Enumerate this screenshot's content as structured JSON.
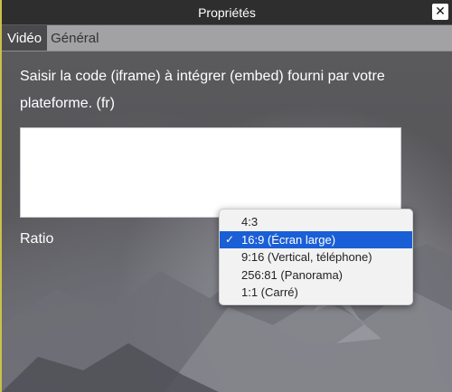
{
  "window": {
    "title": "Propriétés",
    "close_glyph": "✕"
  },
  "tabs": [
    {
      "label": "Vidéo",
      "active": true
    },
    {
      "label": "Général",
      "active": false
    }
  ],
  "form": {
    "prompt": "Saisir la code (iframe) à intégrer (embed) fourni par votre plateforme. (fr)",
    "embed_value": "",
    "ratio_label": "Ratio"
  },
  "ratio_dropdown": {
    "selected": "16:9 (Écran large)",
    "options": [
      {
        "label": "4:3",
        "selected": false
      },
      {
        "label": "16:9 (Écran large)",
        "selected": true
      },
      {
        "label": "9:16 (Vertical, téléphone)",
        "selected": false
      },
      {
        "label": "256:81 (Panorama)",
        "selected": false
      },
      {
        "label": "1:1 (Carré)",
        "selected": false
      }
    ],
    "check_glyph": "✓",
    "selected_color": "#1a5fd6"
  },
  "colors": {
    "titlebar": "#2e2e2e",
    "tabbar": "#a2a2a5",
    "active_tab": "#4a4a4c",
    "window_edge": "#c9c24a"
  }
}
